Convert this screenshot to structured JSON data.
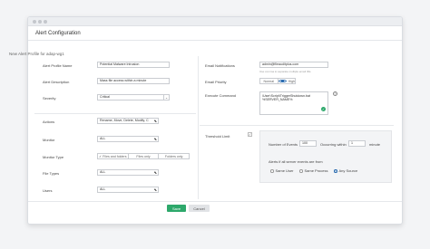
{
  "page": {
    "title": "Alert Configuration",
    "subtitle": "New Alert Profile for adap-wg1"
  },
  "form": {
    "alert_profile_name": {
      "label": "Alert Profile Name",
      "value": "Potential Malware Intrusion"
    },
    "alert_description": {
      "label": "Alert Description",
      "value": "Mass file access within a minute"
    },
    "severity": {
      "label": "Severity",
      "value": "Critical"
    },
    "actions": {
      "label": "Actions",
      "value": "Rename, Move, Delete, Modify, C"
    },
    "monitor": {
      "label": "Monitor",
      "value": "ALL"
    },
    "monitor_type": {
      "label": "Monitor Type",
      "options": [
        "Files and folders",
        "Files only",
        "Folders only"
      ],
      "selected": "Files and folders"
    },
    "file_types": {
      "label": "File Types",
      "value": "ALL"
    },
    "users": {
      "label": "Users",
      "value": "ALL"
    },
    "email_notifications": {
      "label": "Email Notifications",
      "value": "admin@fileauditplus.com",
      "hint": "Use comma to separate multiple email IDs."
    },
    "email_priority": {
      "label": "Email Priority",
      "options": [
        "Normal",
        "High"
      ],
      "selected": "High"
    },
    "execute_command": {
      "label": "Execute Command",
      "value": "\\User\\Script\\TriggerShutdown.bat %SERVER_NAME%"
    },
    "threshold_limit": {
      "label": "Threshold Limit",
      "events_label": "Number of Events",
      "events_value": "100",
      "within_label": "Occurring within",
      "within_value": "1",
      "unit": "minute",
      "scope_label": "Alerts if all server events are from",
      "scope_options": [
        "Same User",
        "Same Process",
        "Any Source"
      ],
      "scope_selected": "Any Source"
    }
  },
  "buttons": {
    "save": "Save",
    "cancel": "Cancel"
  },
  "colors": {
    "accent": "#2da86b"
  }
}
